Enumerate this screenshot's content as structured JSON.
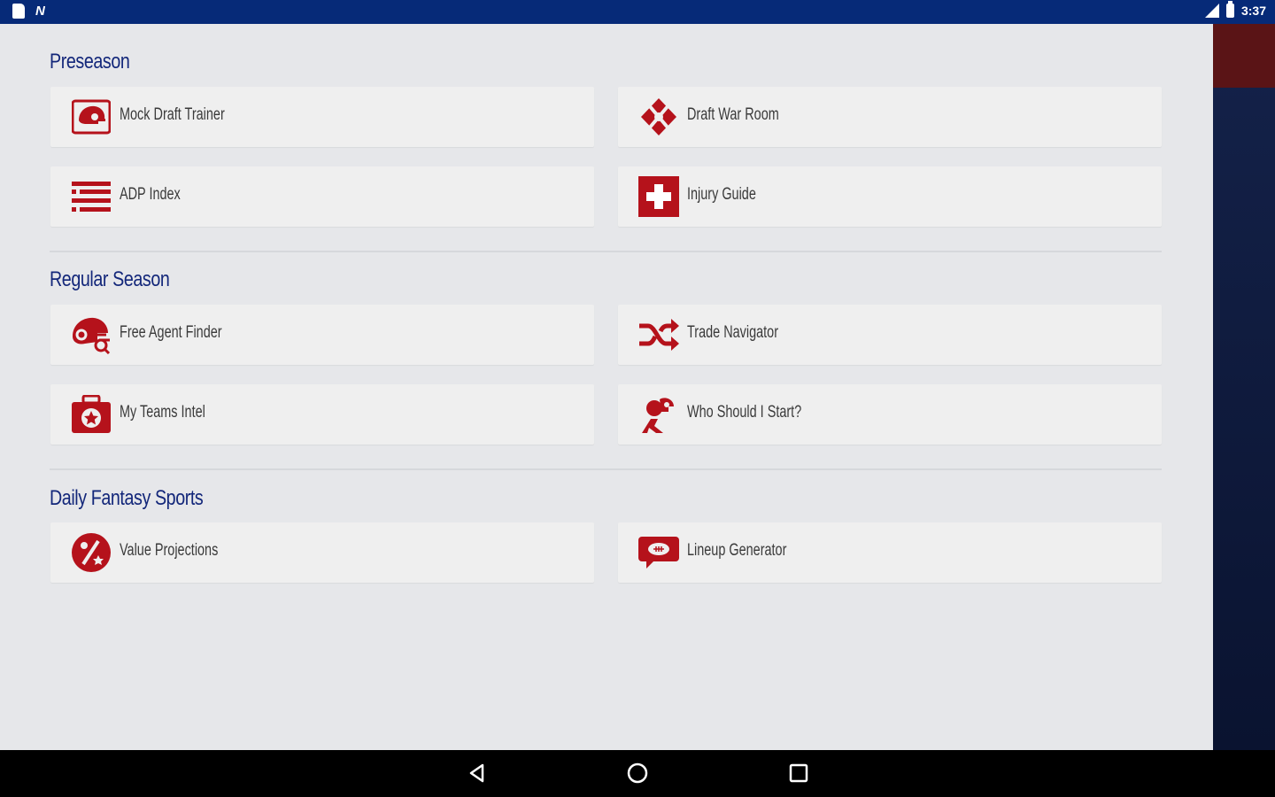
{
  "status_bar": {
    "time": "3:37"
  },
  "colors": {
    "brand_blue": "#13277a",
    "brand_red": "#b5121b",
    "status_bar": "#062a78"
  },
  "sections": [
    {
      "title": "Preseason",
      "tiles": [
        {
          "label": "Mock Draft Trainer",
          "icon": "helmet-icon"
        },
        {
          "label": "Draft War Room",
          "icon": "crossed-swords-icon"
        },
        {
          "label": "ADP Index",
          "icon": "list-lines-icon"
        },
        {
          "label": "Injury Guide",
          "icon": "medical-cross-icon"
        }
      ]
    },
    {
      "title": "Regular Season",
      "tiles": [
        {
          "label": "Free Agent Finder",
          "icon": "helmet-search-icon"
        },
        {
          "label": "Trade Navigator",
          "icon": "shuffle-arrows-icon"
        },
        {
          "label": "My Teams Intel",
          "icon": "briefcase-star-icon"
        },
        {
          "label": "Who Should I Start?",
          "icon": "player-helmet-icon"
        }
      ]
    },
    {
      "title": "Daily Fantasy Sports",
      "tiles": [
        {
          "label": "Value Projections",
          "icon": "percent-icon"
        },
        {
          "label": "Lineup Generator",
          "icon": "football-chat-icon"
        }
      ]
    }
  ]
}
